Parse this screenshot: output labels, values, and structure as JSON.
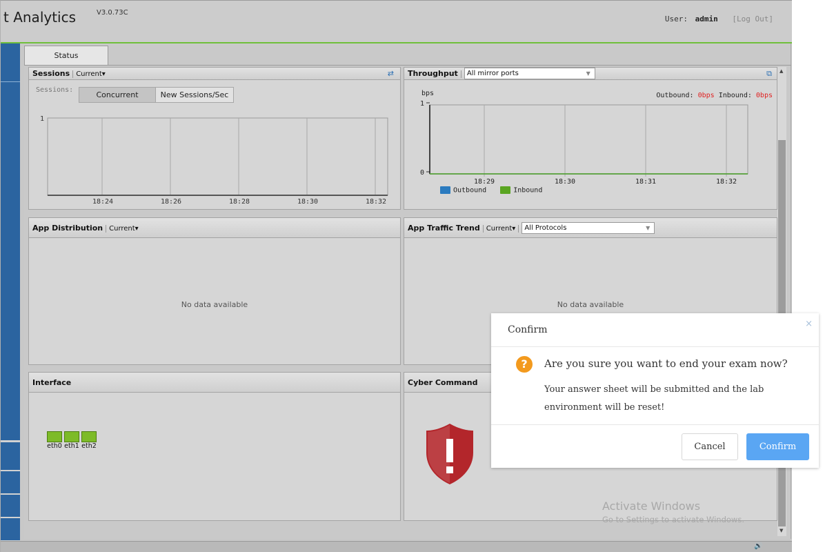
{
  "header": {
    "title": "t Analytics",
    "version": "V3.0.73C",
    "user_label": "User:",
    "user_name": "admin",
    "logout_label": "[Log Out]"
  },
  "tabs": [
    {
      "label": "Status"
    }
  ],
  "sessions": {
    "title": "Sessions",
    "menu": "Current▾",
    "toggle_label": "Sessions:",
    "toggle_options": [
      "Concurrent",
      "New Sessions/Sec"
    ],
    "selected": "Concurrent",
    "chart_data": {
      "type": "line",
      "x": [
        "18:24",
        "18:26",
        "18:28",
        "18:30",
        "18:32"
      ],
      "series": [
        {
          "values": [
            0,
            0,
            0,
            0,
            0
          ]
        }
      ],
      "ylim": [
        0,
        1
      ],
      "y_ticks": [
        "1"
      ],
      "grid": true
    }
  },
  "throughput": {
    "title": "Throughput",
    "select_value": "All mirror ports",
    "outbound_label": "Outbound:",
    "outbound_value": "0bps",
    "inbound_label": "Inbound:",
    "inbound_value": "0bps",
    "value_color": "#e02020",
    "chart_data": {
      "type": "line",
      "ylabel": "bps",
      "x": [
        "18:29",
        "18:30",
        "18:31",
        "18:32"
      ],
      "y_ticks": [
        "1",
        "0"
      ],
      "ylim": [
        0,
        1
      ],
      "series": [
        {
          "name": "Outbound",
          "values": [
            0,
            0,
            0,
            0
          ],
          "color": "#2b7bbf"
        },
        {
          "name": "Inbound",
          "values": [
            0,
            0,
            0,
            0
          ],
          "color": "#5aa521"
        }
      ],
      "legend_position": "bottom-left",
      "grid": true
    }
  },
  "app_distribution": {
    "title": "App Distribution",
    "menu": "Current▾",
    "empty_text": "No data available"
  },
  "app_traffic": {
    "title": "App Traffic Trend",
    "menu": "Current▾",
    "select_value": "All Protocols",
    "empty_text": "No data available"
  },
  "interface": {
    "title": "Interface",
    "ports": [
      "eth0",
      "eth1",
      "eth2"
    ],
    "port_color": "#7dbb28"
  },
  "cyber": {
    "title": "Cyber Command",
    "icon": "warning-shield-icon",
    "icon_color": "#b3262b"
  },
  "dialog": {
    "title": "Confirm",
    "close": "×",
    "icon": "?",
    "message": "Are you sure you want to end your exam now?",
    "detail": "Your answer sheet will be submitted and the lab environment will be reset!",
    "cancel_label": "Cancel",
    "confirm_label": "Confirm",
    "confirm_color": "#5aa6f3"
  },
  "watermark": {
    "line1": "Activate Windows",
    "line2": "Go to Settings to activate Windows."
  },
  "accent_color": "#6fbf3a"
}
